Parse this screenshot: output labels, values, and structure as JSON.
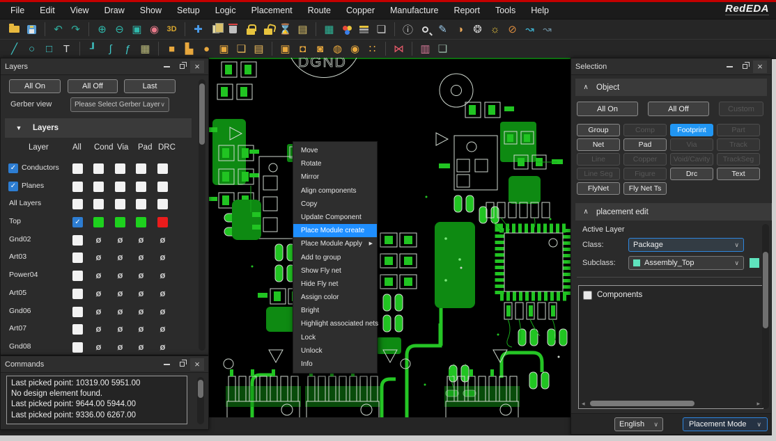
{
  "app": {
    "logo": "RedEDA"
  },
  "menu_bar": {
    "items": [
      "File",
      "Edit",
      "View",
      "Draw",
      "Show",
      "Setup",
      "Logic",
      "Placement",
      "Route",
      "Copper",
      "Manufacture",
      "Report",
      "Tools",
      "Help"
    ]
  },
  "toolbar_main": {
    "icons": [
      {
        "name": "open-file-icon",
        "shape": "folder"
      },
      {
        "name": "save-icon",
        "shape": "save"
      },
      {
        "sep": true
      },
      {
        "name": "undo-icon",
        "glyph": "↶",
        "color": "#2fae9e"
      },
      {
        "name": "redo-icon",
        "glyph": "↷",
        "color": "#2fae9e"
      },
      {
        "sep": true
      },
      {
        "name": "zoom-in-icon",
        "glyph": "⊕",
        "color": "#2fb8ab"
      },
      {
        "name": "zoom-out-icon",
        "glyph": "⊖",
        "color": "#2fb8ab"
      },
      {
        "name": "zoom-fit-icon",
        "glyph": "▣",
        "color": "#2fb8ab"
      },
      {
        "name": "zoom-region-icon",
        "glyph": "◉",
        "color": "#e87a8a"
      },
      {
        "name": "view-3d-icon",
        "text": "3D",
        "color": "#d9a72e"
      },
      {
        "sep": true
      },
      {
        "name": "move-icon",
        "glyph": "✚",
        "color": "#4a9ae8"
      },
      {
        "name": "copy-icon",
        "shape": "copy"
      },
      {
        "name": "delete-icon",
        "shape": "trash"
      },
      {
        "name": "lock-icon",
        "shape": "lock"
      },
      {
        "name": "unlock-icon",
        "shape": "unlock"
      },
      {
        "name": "hourglass-icon",
        "glyph": "⌛",
        "color": "#c8b35a"
      },
      {
        "name": "sheet-icon",
        "glyph": "▤",
        "color": "#d9c06a"
      },
      {
        "sep": true
      },
      {
        "name": "grid-icon",
        "glyph": "▦",
        "color": "#2fb89a"
      },
      {
        "name": "color-mix-icon",
        "shape": "rgb"
      },
      {
        "name": "layers-icon",
        "shape": "layers"
      },
      {
        "name": "frame-icon",
        "glyph": "❏",
        "color": "#cfcfcf"
      },
      {
        "sep": true
      },
      {
        "name": "info-icon",
        "glyph": "ⓘ",
        "color": "#d0d0d0"
      },
      {
        "name": "search-icon",
        "shape": "search"
      },
      {
        "name": "measure-icon",
        "glyph": "✎",
        "color": "#9ac8e8"
      },
      {
        "name": "palette-icon",
        "glyph": "◑",
        "color": "#e8a75a"
      },
      {
        "name": "stamp-icon",
        "glyph": "❂",
        "color": "#cfcfcf"
      },
      {
        "name": "sun-gear-icon",
        "glyph": "☼",
        "color": "#e8c43e"
      },
      {
        "name": "gear-off-icon",
        "glyph": "⊘",
        "color": "#d88a3e"
      },
      {
        "name": "flyline-show-icon",
        "glyph": "↝",
        "color": "#3fb8d8"
      },
      {
        "name": "flyline-hide-icon",
        "glyph": "↝",
        "color": "#6a8a9a"
      }
    ]
  },
  "toolbar_draw": {
    "icons": [
      {
        "name": "draw-line-icon",
        "glyph": "╱",
        "color": "#3fc8c8"
      },
      {
        "name": "draw-circle-icon",
        "glyph": "○",
        "color": "#3fc8c8"
      },
      {
        "name": "draw-rect-icon",
        "glyph": "□",
        "color": "#3fc8c8"
      },
      {
        "name": "draw-text-icon",
        "glyph": "T",
        "color": "#d8d8d8"
      },
      {
        "sep": true
      },
      {
        "name": "draw-corner-icon",
        "glyph": "┚",
        "color": "#3fc8c8"
      },
      {
        "name": "draw-contour-icon",
        "glyph": "∫",
        "color": "#3fc8c8"
      },
      {
        "name": "draw-function-icon",
        "glyph": "ƒ",
        "color": "#3fc8c8"
      },
      {
        "name": "draw-mesh-icon",
        "glyph": "▦",
        "color": "#b8b87a"
      },
      {
        "sep": true
      },
      {
        "name": "fill-rect-icon",
        "glyph": "■",
        "color": "#e8a83e"
      },
      {
        "name": "fill-lshape-icon",
        "glyph": "▙",
        "color": "#e8a83e"
      },
      {
        "name": "fill-ellipse-icon",
        "glyph": "●",
        "color": "#e8a83e"
      },
      {
        "name": "fill-inspect-icon",
        "glyph": "▣",
        "color": "#e8a83e"
      },
      {
        "name": "sheets-icon",
        "glyph": "❏",
        "color": "#e8b85a"
      },
      {
        "name": "sheet-single-icon",
        "glyph": "▤",
        "color": "#e8b85a"
      },
      {
        "sep": true
      },
      {
        "name": "cutout-rect-icon",
        "glyph": "▣",
        "color": "#e8a83e"
      },
      {
        "name": "cutout-lshape-icon",
        "glyph": "◘",
        "color": "#e8a83e"
      },
      {
        "name": "cutout-circle-icon",
        "glyph": "◙",
        "color": "#e8a83e"
      },
      {
        "name": "cutout-multi-icon",
        "glyph": "◍",
        "color": "#e8a83e"
      },
      {
        "name": "cutout-dot-icon",
        "glyph": "◉",
        "color": "#e8a83e"
      },
      {
        "name": "cutout-dots-icon",
        "glyph": "∷",
        "color": "#e8a83e"
      },
      {
        "sep": true
      },
      {
        "name": "net-cross-icon",
        "glyph": "⋈",
        "color": "#e85a6a"
      },
      {
        "sep": true
      },
      {
        "name": "report-chart-icon",
        "glyph": "▥",
        "color": "#d87a9a"
      },
      {
        "name": "window-grid-icon",
        "glyph": "❏",
        "color": "#9ab8a8"
      }
    ]
  },
  "layers_panel": {
    "title": "Layers",
    "buttons": [
      "All On",
      "All Off",
      "Last"
    ],
    "gerber_view_label": "Gerber view",
    "gerber_dropdown_value": "Please Select Gerber Layer",
    "section_title": "Layers",
    "table_headers": [
      "Layer",
      "All",
      "Cond",
      "Via",
      "Pad",
      "DRC"
    ],
    "rows": [
      {
        "label": "Conductors",
        "checkbox": true,
        "cells": [
          "w",
          "w",
          "w",
          "w",
          "w"
        ]
      },
      {
        "label": "Planes",
        "checkbox": true,
        "cells": [
          "w",
          "w",
          "w",
          "w",
          "w"
        ]
      },
      {
        "label": "All Layers",
        "checkbox": false,
        "cells": [
          "w",
          "w",
          "w",
          "w",
          "w"
        ]
      },
      {
        "label": "Top",
        "checkbox": false,
        "cells": [
          "c",
          "g",
          "g",
          "g",
          "r"
        ]
      },
      {
        "label": "Gnd02",
        "checkbox": false,
        "cells": [
          "w",
          "e",
          "e",
          "e",
          "e"
        ]
      },
      {
        "label": "Art03",
        "checkbox": false,
        "cells": [
          "w",
          "e",
          "e",
          "e",
          "e"
        ]
      },
      {
        "label": "Power04",
        "checkbox": false,
        "cells": [
          "w",
          "e",
          "e",
          "e",
          "e"
        ]
      },
      {
        "label": "Art05",
        "checkbox": false,
        "cells": [
          "w",
          "e",
          "e",
          "e",
          "e"
        ]
      },
      {
        "label": "Gnd06",
        "checkbox": false,
        "cells": [
          "w",
          "e",
          "e",
          "e",
          "e"
        ]
      },
      {
        "label": "Art07",
        "checkbox": false,
        "cells": [
          "w",
          "e",
          "e",
          "e",
          "e"
        ]
      },
      {
        "label": "Gnd08",
        "checkbox": false,
        "cells": [
          "w",
          "e",
          "e",
          "e",
          "e"
        ]
      }
    ]
  },
  "commands_panel": {
    "title": "Commands",
    "lines": [
      "Last picked point: 10319.00 5951.00",
      "No design element found.",
      "Last picked point: 9644.00 5944.00",
      "Last picked point: 9336.00 6267.00"
    ]
  },
  "canvas": {
    "dgnd_label": "DGND"
  },
  "context_menu": {
    "items": [
      {
        "label": "Move"
      },
      {
        "label": "Rotate"
      },
      {
        "label": "Mirror"
      },
      {
        "label": "Align components"
      },
      {
        "label": "Copy"
      },
      {
        "label": "Update Component"
      },
      {
        "label": "Place Module create",
        "highlighted": true
      },
      {
        "label": "Place Module Apply",
        "submenu": true
      },
      {
        "label": "Add to group"
      },
      {
        "label": "Show Fly net"
      },
      {
        "label": "Hide Fly net"
      },
      {
        "label": "Assign color"
      },
      {
        "label": "Bright"
      },
      {
        "label": "Highlight associated nets"
      },
      {
        "label": "Lock"
      },
      {
        "label": "Unlock"
      },
      {
        "label": "Info"
      }
    ]
  },
  "selection_panel": {
    "title": "Selection",
    "object_section_title": "Object",
    "top_buttons": [
      {
        "label": "All On",
        "state": "normal"
      },
      {
        "label": "All Off",
        "state": "normal"
      },
      {
        "label": "Custom",
        "state": "disabled"
      }
    ],
    "filter_buttons": [
      {
        "label": "Group",
        "state": "normal"
      },
      {
        "label": "Comp",
        "state": "disabled"
      },
      {
        "label": "Footprint",
        "state": "active"
      },
      {
        "label": "Part",
        "state": "disabled"
      },
      {
        "label": "Net",
        "state": "normal"
      },
      {
        "label": "Pad",
        "state": "normal"
      },
      {
        "label": "Via",
        "state": "disabled"
      },
      {
        "label": "Track",
        "state": "disabled"
      },
      {
        "label": "Line",
        "state": "disabled"
      },
      {
        "label": "Copper",
        "state": "disabled"
      },
      {
        "label": "Void/Cavity",
        "state": "disabled"
      },
      {
        "label": "TrackSeg",
        "state": "disabled"
      },
      {
        "label": "Line Seg",
        "state": "disabled"
      },
      {
        "label": "Figure",
        "state": "disabled"
      },
      {
        "label": "Drc",
        "state": "normal"
      },
      {
        "label": "Text",
        "state": "normal"
      },
      {
        "label": "FlyNet",
        "state": "normal"
      },
      {
        "label": "Fly Net Ts",
        "state": "normal"
      }
    ],
    "placement_section_title": "placement edit",
    "active_layer_label": "Active Layer",
    "class_label": "Class:",
    "class_value": "Package",
    "subclass_label": "Subclass:",
    "subclass_value": "Assembly_Top",
    "components_label": "Components",
    "footer": {
      "language": "English",
      "mode": "Placement Mode"
    }
  },
  "colors": {
    "top_line_red": "#c40000",
    "accent_blue": "#2196f3",
    "menu_highlight_blue": "#1f8fff",
    "checkbox_blue": "#2d7dd2",
    "layer_on_green": "#1ed11e",
    "layer_drc_red": "#ea1c1c",
    "subclass_mint": "#5fe3bd",
    "pcb_pour_green": "#0e8a12",
    "pcb_pad_green": "#21c422",
    "pcb_outline_white": "#d8e0d8"
  }
}
